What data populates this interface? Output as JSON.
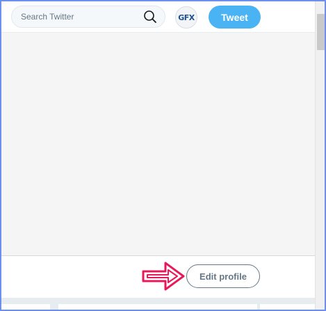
{
  "search": {
    "placeholder": "Search Twitter"
  },
  "avatar": {
    "text": "GFX"
  },
  "toolbar": {
    "tweet_label": "Tweet"
  },
  "profile": {
    "edit_label": "Edit profile"
  },
  "colors": {
    "accent": "#4ab3f4",
    "annotation_arrow": "#e8185a",
    "frame_border": "#6d8ff0"
  },
  "icons": {
    "search": "search-icon",
    "annotation": "arrow-right-icon"
  }
}
